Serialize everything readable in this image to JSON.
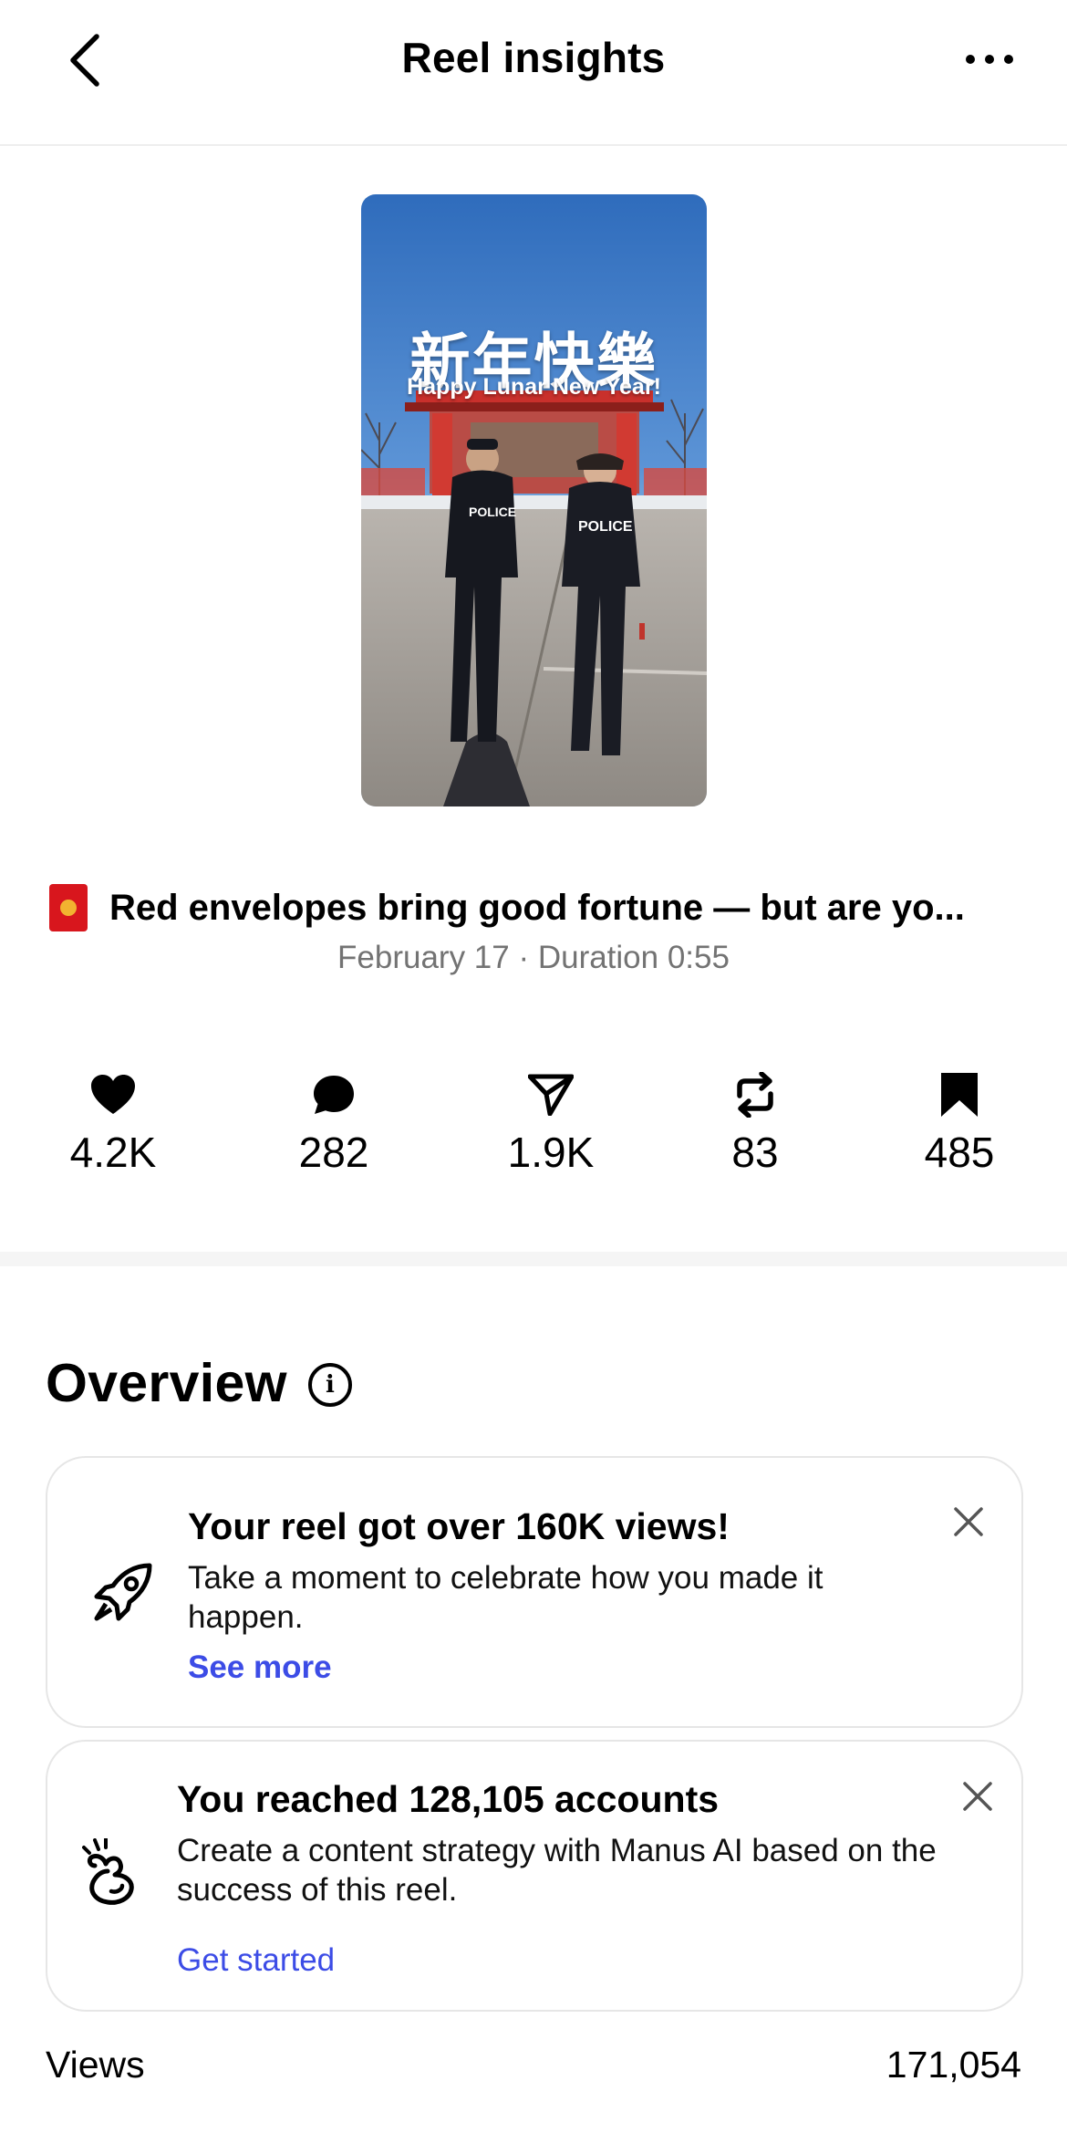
{
  "header": {
    "title": "Reel insights",
    "back_icon": "chevron-left-icon",
    "more_icon": "more-horizontal-icon"
  },
  "thumbnail": {
    "chinese_text": "新年快樂",
    "english_text": "Happy Lunar New Year!",
    "badge_left": "POLICE",
    "badge_right": "POLICE"
  },
  "reel": {
    "emoji_icon": "red-envelope-icon",
    "title": "Red envelopes bring good fortune — but are yo...",
    "meta": "February 17 · Duration 0:55"
  },
  "stats": [
    {
      "icon": "heart-icon",
      "value": "4.2K"
    },
    {
      "icon": "comment-icon",
      "value": "282"
    },
    {
      "icon": "share-icon",
      "value": "1.9K"
    },
    {
      "icon": "repost-icon",
      "value": "83"
    },
    {
      "icon": "bookmark-icon",
      "value": "485"
    }
  ],
  "overview": {
    "heading": "Overview",
    "info_symbol": "i"
  },
  "cards": [
    {
      "icon": "rocket-icon",
      "title": "Your reel got over 160K views!",
      "body": "Take a moment to celebrate how you made it happen.",
      "link": "See more"
    },
    {
      "icon": "manus-hand-icon",
      "title": "You reached 128,105 accounts",
      "body": "Create a content strategy with Manus AI based on the success of this reel.",
      "link": "Get started"
    }
  ],
  "views": {
    "label": "Views",
    "value": "171,054"
  },
  "colors": {
    "link_primary": "#3c4ce6",
    "muted_text": "#737373",
    "divider": "#f5f5f5"
  }
}
